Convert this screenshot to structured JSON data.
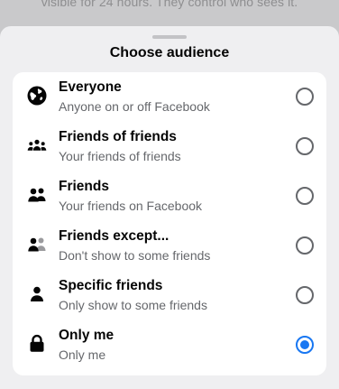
{
  "background": {
    "text": "visible for 24 hours. They control who sees it."
  },
  "sheet": {
    "title": "Choose audience"
  },
  "options": [
    {
      "title": "Everyone",
      "subtitle": "Anyone on or off Facebook",
      "icon": "globe-icon",
      "selected": false
    },
    {
      "title": "Friends of friends",
      "subtitle": "Your friends of friends",
      "icon": "friends-of-friends-icon",
      "selected": false
    },
    {
      "title": "Friends",
      "subtitle": "Your friends on Facebook",
      "icon": "friends-icon",
      "selected": false
    },
    {
      "title": "Friends except...",
      "subtitle": "Don't show to some friends",
      "icon": "friends-except-icon",
      "selected": false
    },
    {
      "title": "Specific friends",
      "subtitle": "Only show to some friends",
      "icon": "specific-friend-icon",
      "selected": false
    },
    {
      "title": "Only me",
      "subtitle": "Only me",
      "icon": "lock-icon",
      "selected": true
    }
  ],
  "colors": {
    "accent": "#1877f2",
    "primary_text": "#050505",
    "secondary_text": "#65676b",
    "sheet_background": "#efeff1",
    "card_background": "#ffffff"
  }
}
